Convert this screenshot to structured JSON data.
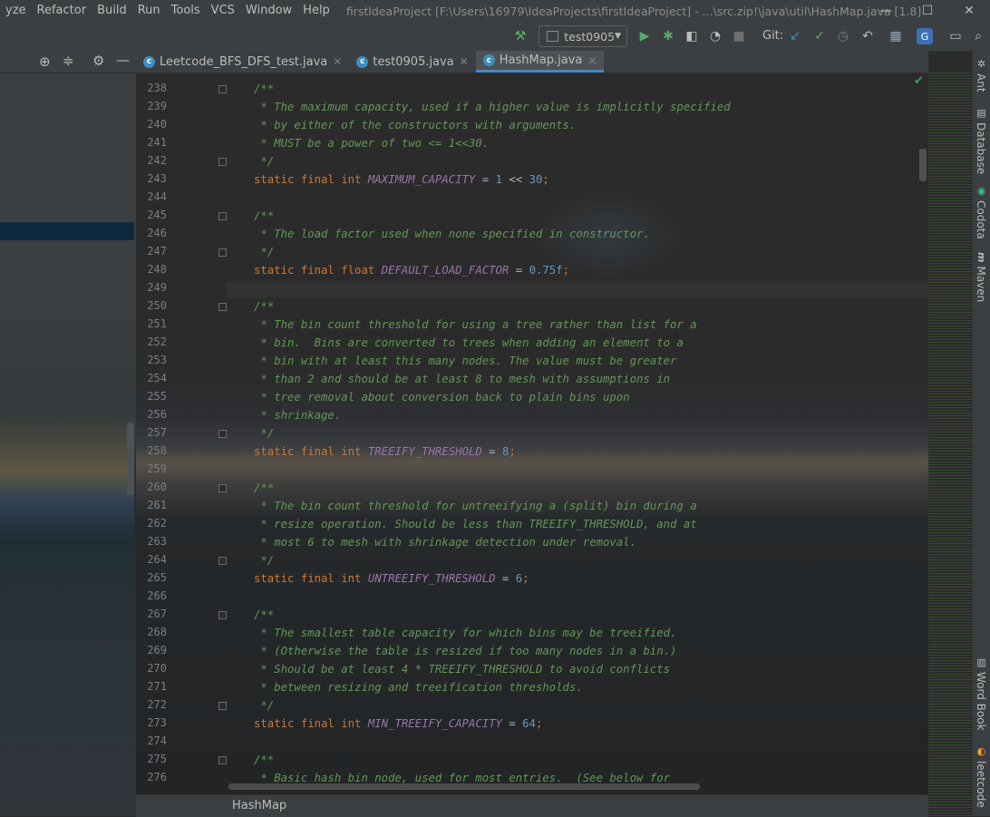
{
  "menu": [
    {
      "label": "yze"
    },
    {
      "label": "Refactor"
    },
    {
      "label": "Build"
    },
    {
      "label": "Run"
    },
    {
      "label": "Tools"
    },
    {
      "label": "VCS"
    },
    {
      "label": "Window"
    },
    {
      "label": "Help"
    }
  ],
  "window_title": "firstIdeaProject [F:\\Users\\16979\\IdeaProjects\\firstIdeaProject] - ...\\src.zip!\\java\\util\\HashMap.java [1.8]",
  "window_controls": {
    "minimize": "—",
    "maximize": "☐",
    "close": "✕"
  },
  "toolbar": {
    "run_config": "test0905",
    "git_label": "Git:"
  },
  "tabs": [
    {
      "label": "Leetcode_BFS_DFS_test.java",
      "active": false
    },
    {
      "label": "test0905.java",
      "active": false
    },
    {
      "label": "HashMap.java",
      "active": true
    }
  ],
  "code": {
    "lines": [
      {
        "num": "238",
        "segments": [
          {
            "c": "doc",
            "t": "/**"
          }
        ]
      },
      {
        "num": "239",
        "segments": [
          {
            "c": "doc",
            "t": " * The maximum capacity, used if a higher value is implicitly specified"
          }
        ]
      },
      {
        "num": "240",
        "segments": [
          {
            "c": "doc",
            "t": " * by either of the constructors with arguments."
          }
        ]
      },
      {
        "num": "241",
        "segments": [
          {
            "c": "doc",
            "t": " * MUST be a power of two <= 1<<30."
          }
        ]
      },
      {
        "num": "242",
        "segments": [
          {
            "c": "doc",
            "t": " */"
          }
        ]
      },
      {
        "num": "243",
        "segments": [
          {
            "c": "kw",
            "t": "static final int "
          },
          {
            "c": "field",
            "t": "MAXIMUM_CAPACITY"
          },
          {
            "c": "plain",
            "t": " = "
          },
          {
            "c": "num",
            "t": "1"
          },
          {
            "c": "plain",
            "t": " << "
          },
          {
            "c": "num",
            "t": "30"
          },
          {
            "c": "kw",
            "t": ";"
          }
        ]
      },
      {
        "num": "244",
        "segments": []
      },
      {
        "num": "245",
        "segments": [
          {
            "c": "doc",
            "t": "/**"
          }
        ]
      },
      {
        "num": "246",
        "segments": [
          {
            "c": "doc",
            "t": " * The load factor used when none specified in constructor."
          }
        ]
      },
      {
        "num": "247",
        "segments": [
          {
            "c": "doc",
            "t": " */"
          }
        ]
      },
      {
        "num": "248",
        "segments": [
          {
            "c": "kw",
            "t": "static final float "
          },
          {
            "c": "field",
            "t": "DEFAULT_LOAD_FACTOR"
          },
          {
            "c": "plain",
            "t": " = "
          },
          {
            "c": "num",
            "t": "0.75f"
          },
          {
            "c": "kw",
            "t": ";"
          }
        ]
      },
      {
        "num": "249",
        "segments": []
      },
      {
        "num": "250",
        "segments": [
          {
            "c": "doc",
            "t": "/**"
          }
        ]
      },
      {
        "num": "251",
        "segments": [
          {
            "c": "doc",
            "t": " * The bin count threshold for using a tree rather than list for a"
          }
        ]
      },
      {
        "num": "252",
        "segments": [
          {
            "c": "doc",
            "t": " * bin.  Bins are converted to trees when adding an element to a"
          }
        ]
      },
      {
        "num": "253",
        "segments": [
          {
            "c": "doc",
            "t": " * bin with at least this many nodes. The value must be greater"
          }
        ]
      },
      {
        "num": "254",
        "segments": [
          {
            "c": "doc",
            "t": " * than 2 and should be at least 8 to mesh with assumptions in"
          }
        ]
      },
      {
        "num": "255",
        "segments": [
          {
            "c": "doc",
            "t": " * tree removal about conversion back to plain bins upon"
          }
        ]
      },
      {
        "num": "256",
        "segments": [
          {
            "c": "doc",
            "t": " * shrinkage."
          }
        ]
      },
      {
        "num": "257",
        "segments": [
          {
            "c": "doc",
            "t": " */"
          }
        ]
      },
      {
        "num": "258",
        "segments": [
          {
            "c": "kw",
            "t": "static final int "
          },
          {
            "c": "field",
            "t": "TREEIFY_THRESHOLD"
          },
          {
            "c": "plain",
            "t": " = "
          },
          {
            "c": "num",
            "t": "8"
          },
          {
            "c": "kw",
            "t": ";"
          }
        ]
      },
      {
        "num": "259",
        "segments": []
      },
      {
        "num": "260",
        "segments": [
          {
            "c": "doc",
            "t": "/**"
          }
        ]
      },
      {
        "num": "261",
        "segments": [
          {
            "c": "doc",
            "t": " * The bin count threshold for untreeifying a (split) bin during a"
          }
        ]
      },
      {
        "num": "262",
        "segments": [
          {
            "c": "doc",
            "t": " * resize operation. Should be less than TREEIFY_THRESHOLD, and at"
          }
        ]
      },
      {
        "num": "263",
        "segments": [
          {
            "c": "doc",
            "t": " * most 6 to mesh with shrinkage detection under removal."
          }
        ]
      },
      {
        "num": "264",
        "segments": [
          {
            "c": "doc",
            "t": " */"
          }
        ]
      },
      {
        "num": "265",
        "segments": [
          {
            "c": "kw",
            "t": "static final int "
          },
          {
            "c": "field",
            "t": "UNTREEIFY_THRESHOLD"
          },
          {
            "c": "plain",
            "t": " = "
          },
          {
            "c": "num",
            "t": "6"
          },
          {
            "c": "kw",
            "t": ";"
          }
        ]
      },
      {
        "num": "266",
        "segments": []
      },
      {
        "num": "267",
        "segments": [
          {
            "c": "doc",
            "t": "/**"
          }
        ]
      },
      {
        "num": "268",
        "segments": [
          {
            "c": "doc",
            "t": " * The smallest table capacity for which bins may be treeified."
          }
        ]
      },
      {
        "num": "269",
        "segments": [
          {
            "c": "doc",
            "t": " * (Otherwise the table is resized if too many nodes in a bin.)"
          }
        ]
      },
      {
        "num": "270",
        "segments": [
          {
            "c": "doc",
            "t": " * Should be at least 4 * TREEIFY_THRESHOLD to avoid conflicts"
          }
        ]
      },
      {
        "num": "271",
        "segments": [
          {
            "c": "doc",
            "t": " * between resizing and treeification thresholds."
          }
        ]
      },
      {
        "num": "272",
        "segments": [
          {
            "c": "doc",
            "t": " */"
          }
        ]
      },
      {
        "num": "273",
        "segments": [
          {
            "c": "kw",
            "t": "static final int "
          },
          {
            "c": "field",
            "t": "MIN_TREEIFY_CAPACITY"
          },
          {
            "c": "plain",
            "t": " = "
          },
          {
            "c": "num",
            "t": "64"
          },
          {
            "c": "kw",
            "t": ";"
          }
        ]
      },
      {
        "num": "274",
        "segments": []
      },
      {
        "num": "275",
        "segments": [
          {
            "c": "doc",
            "t": "/**"
          }
        ]
      },
      {
        "num": "276",
        "segments": [
          {
            "c": "doc",
            "t": " * Basic hash bin node, used for most entries.  (See below for"
          }
        ]
      }
    ]
  },
  "breadcrumb": "HashMap",
  "right_tools": [
    {
      "label": "Ant",
      "icon": "ant-icon"
    },
    {
      "label": "Database",
      "icon": "database-icon"
    },
    {
      "label": "Codota",
      "icon": "codota-icon"
    },
    {
      "label": "Maven",
      "icon": "maven-icon"
    },
    {
      "label": "Word Book",
      "icon": "book-icon"
    },
    {
      "label": "leetcode",
      "icon": "leetcode-icon"
    }
  ],
  "colors": {
    "doc_comment": "#629755",
    "keyword": "#cc7832",
    "field": "#9876aa",
    "number": "#6897bb",
    "background": "#2b2b2b",
    "panel": "#3c3f41",
    "accent": "#4a88c7"
  }
}
